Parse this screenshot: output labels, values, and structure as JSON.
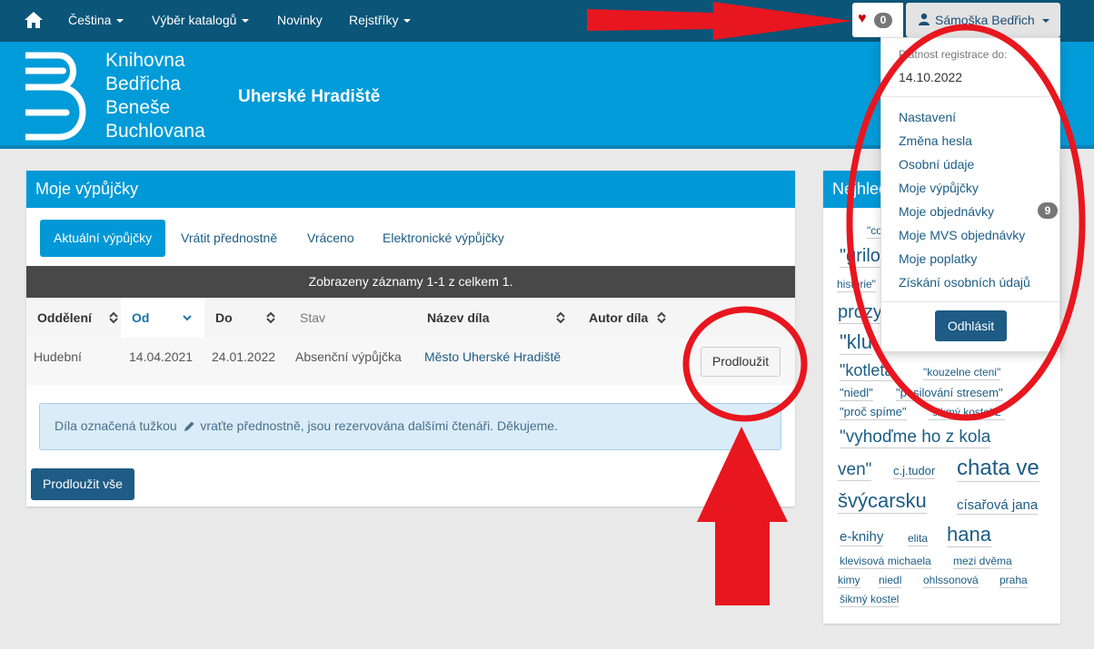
{
  "topnav": {
    "items": [
      {
        "label": "Čeština"
      },
      {
        "label": "Výběr katalogů"
      },
      {
        "label": "Novinky"
      },
      {
        "label": "Rejstříky"
      }
    ],
    "favorites_count": "0",
    "user_name": "Sámoška Bedřich"
  },
  "banner": {
    "logo_lines": [
      "Knihovna",
      "Bedřicha",
      "Beneše",
      "Buchlovana"
    ],
    "city": "Uherské Hradiště"
  },
  "loans": {
    "title": "Moje výpůjčky",
    "tabs": [
      {
        "label": "Aktuální výpůjčky"
      },
      {
        "label": "Vrátit přednostně"
      },
      {
        "label": "Vráceno"
      },
      {
        "label": "Elektronické výpůjčky"
      }
    ],
    "summary": "Zobrazeny záznamy 1-1 z celkem 1.",
    "columns": [
      {
        "label": "Oddělení"
      },
      {
        "label": "Od"
      },
      {
        "label": "Do"
      },
      {
        "label": "Stav"
      },
      {
        "label": "Název díla"
      },
      {
        "label": "Autor díla"
      }
    ],
    "rows": [
      {
        "department": "Hudební",
        "from": "14.04.2021",
        "to": "24.01.2022",
        "status": "Absenční výpůjčka",
        "title": "Město Uherské Hradiště",
        "renew_label": "Prodloužit"
      }
    ],
    "notice_before": "Díla označená tužkou",
    "notice_after": "vraťte přednostně, jsou rezervována dalšími čtenáři. Děkujeme.",
    "renew_all": "Prodloužit vše"
  },
  "sidebar": {
    "title": "Nejhled",
    "tags": [
      "\"co",
      "\"grilo",
      "historie\"",
      "prozy",
      "\"klu",
      "\"kotleta",
      "\"kouzelne cteni\"",
      "\"niedl\"",
      "\"posilování stresem\"",
      "\"proč spíme\"",
      "\"šikmý kostel 2\"",
      "\"vyhoďme ho z kola",
      "ven\"",
      "c.j.tudor",
      "chata ve",
      "švýcarsku",
      "císařová jana",
      "e-knihy",
      "elita",
      "hana",
      "klevisová michaela",
      "mezi dvěma",
      "kimy",
      "niedl",
      "ohlssonová",
      "praha",
      "šikmý kostel"
    ]
  },
  "user_menu": {
    "registration_label": "Platnost registrace do:",
    "registration_date": "14.10.2022",
    "items": [
      {
        "label": "Nastavení"
      },
      {
        "label": "Změna hesla"
      },
      {
        "label": "Osobní údaje"
      },
      {
        "label": "Moje výpůjčky"
      },
      {
        "label": "Moje objednávky",
        "badge": "9"
      },
      {
        "label": "Moje MVS objednávky"
      },
      {
        "label": "Moje poplatky"
      },
      {
        "label": "Získání osobních údajů"
      }
    ],
    "logout": "Odhlásit"
  },
  "colors": {
    "nav": "#0a5578",
    "banner": "#009bd9",
    "panel_head": "#0099d8",
    "annotation_red": "#e8161f"
  }
}
